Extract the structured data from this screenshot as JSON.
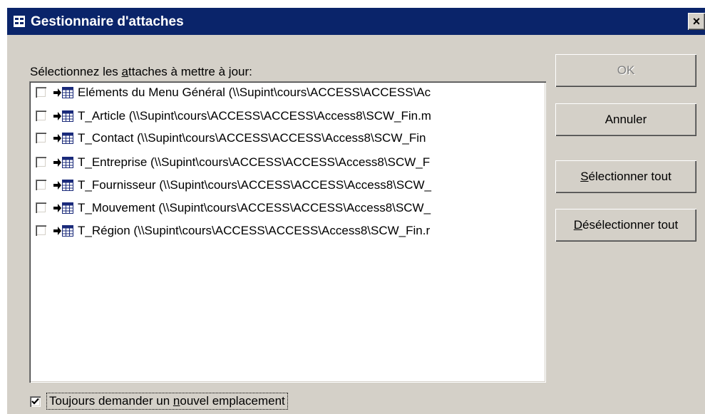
{
  "window": {
    "title": "Gestionnaire d'attaches",
    "close_glyph": "×"
  },
  "prompt": {
    "before": "Sélectionnez les ",
    "mnemonic": "a",
    "after": "ttaches à mettre à jour:"
  },
  "items": [
    {
      "text": "Eléments du Menu Général   (\\\\Supint\\cours\\ACCESS\\ACCESS\\Ac",
      "checked": false
    },
    {
      "text": "T_Article   (\\\\Supint\\cours\\ACCESS\\ACCESS\\Access8\\SCW_Fin.m",
      "checked": false
    },
    {
      "text": "T_Contact   (\\\\Supint\\cours\\ACCESS\\ACCESS\\Access8\\SCW_Fin",
      "checked": false
    },
    {
      "text": "T_Entreprise   (\\\\Supint\\cours\\ACCESS\\ACCESS\\Access8\\SCW_F",
      "checked": false
    },
    {
      "text": "T_Fournisseur   (\\\\Supint\\cours\\ACCESS\\ACCESS\\Access8\\SCW_",
      "checked": false
    },
    {
      "text": "T_Mouvement   (\\\\Supint\\cours\\ACCESS\\ACCESS\\Access8\\SCW_",
      "checked": false
    },
    {
      "text": "T_Région   (\\\\Supint\\cours\\ACCESS\\ACCESS\\Access8\\SCW_Fin.r",
      "checked": false
    }
  ],
  "buttons": {
    "ok": {
      "label": "OK",
      "enabled": false
    },
    "cancel": {
      "label": "Annuler"
    },
    "select_all": {
      "mnemonic": "S",
      "rest": "électionner tout"
    },
    "deselect_all": {
      "mnemonic": "D",
      "rest": "ésélectionner tout"
    }
  },
  "always_ask": {
    "before": "Toujours demander un ",
    "mnemonic": "n",
    "after": "ouvel emplacement",
    "checked": true
  },
  "icons": {
    "app": "form-icon",
    "link": "link-arrow-icon",
    "table": "table-icon",
    "check": "checkmark-icon"
  },
  "colors": {
    "titlebar": "#0a246a",
    "face": "#d4d0c8",
    "table_icon": "#1a2a7a",
    "disabled_text": "#808080"
  }
}
